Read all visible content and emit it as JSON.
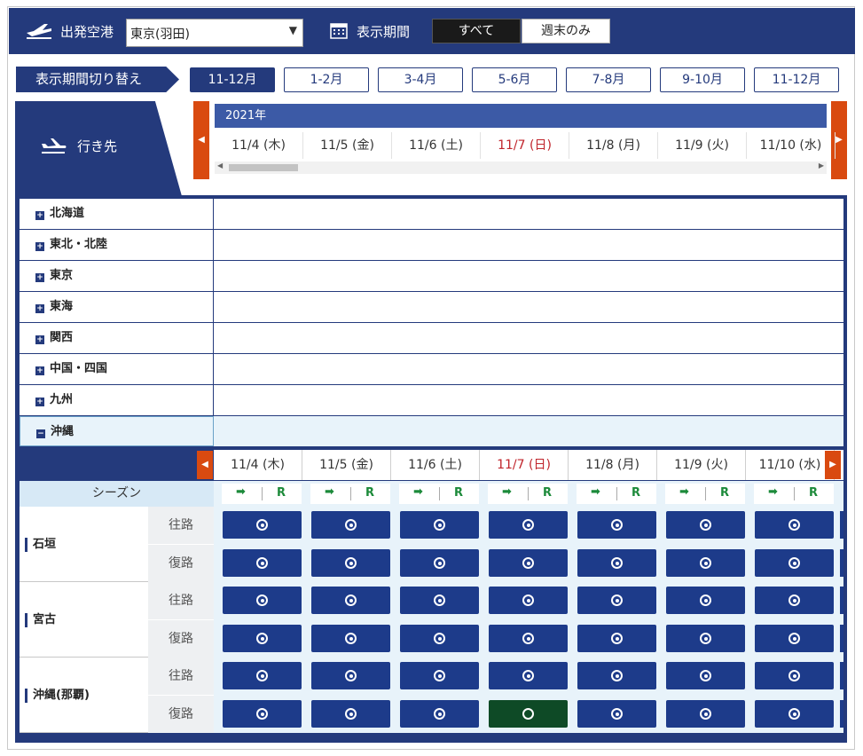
{
  "header": {
    "airport_label": "出発空港",
    "airport_value": "東京(羽田)",
    "period_label": "表示期間",
    "btn_all": "すべて",
    "btn_weekend": "週末のみ"
  },
  "period_switch": {
    "label": "表示期間切り替え",
    "buttons": [
      "11-12月",
      "1-2月",
      "3-4月",
      "5-6月",
      "7-8月",
      "9-10月",
      "11-12月"
    ],
    "active_index": 0
  },
  "destination_tab": "行き先",
  "year": "2021年",
  "dates": [
    {
      "label": "11/4 (木)",
      "sunday": false
    },
    {
      "label": "11/5 (金)",
      "sunday": false
    },
    {
      "label": "11/6 (土)",
      "sunday": false
    },
    {
      "label": "11/7 (日)",
      "sunday": true
    },
    {
      "label": "11/8 (月)",
      "sunday": false
    },
    {
      "label": "11/9 (火)",
      "sunday": false
    },
    {
      "label": "11/10 (水)",
      "sunday": false
    }
  ],
  "regions": [
    {
      "name": "北海道",
      "open": false
    },
    {
      "name": "東北・北陸",
      "open": false
    },
    {
      "name": "東京",
      "open": false
    },
    {
      "name": "東海",
      "open": false
    },
    {
      "name": "関西",
      "open": false
    },
    {
      "name": "中国・四国",
      "open": false
    },
    {
      "name": "九州",
      "open": false
    },
    {
      "name": "沖縄",
      "open": true
    }
  ],
  "season_label": "シーズン",
  "legend": {
    "arrow": "➡",
    "r": "R"
  },
  "destinations": [
    {
      "name": "石垣",
      "outbound": "往路",
      "return": "復路"
    },
    {
      "name": "宮古",
      "outbound": "往路",
      "return": "復路"
    },
    {
      "name": "沖縄(那覇)",
      "outbound": "往路",
      "return": "復路"
    }
  ],
  "selected": {
    "destination": 2,
    "direction": "return",
    "date_index": 3
  }
}
